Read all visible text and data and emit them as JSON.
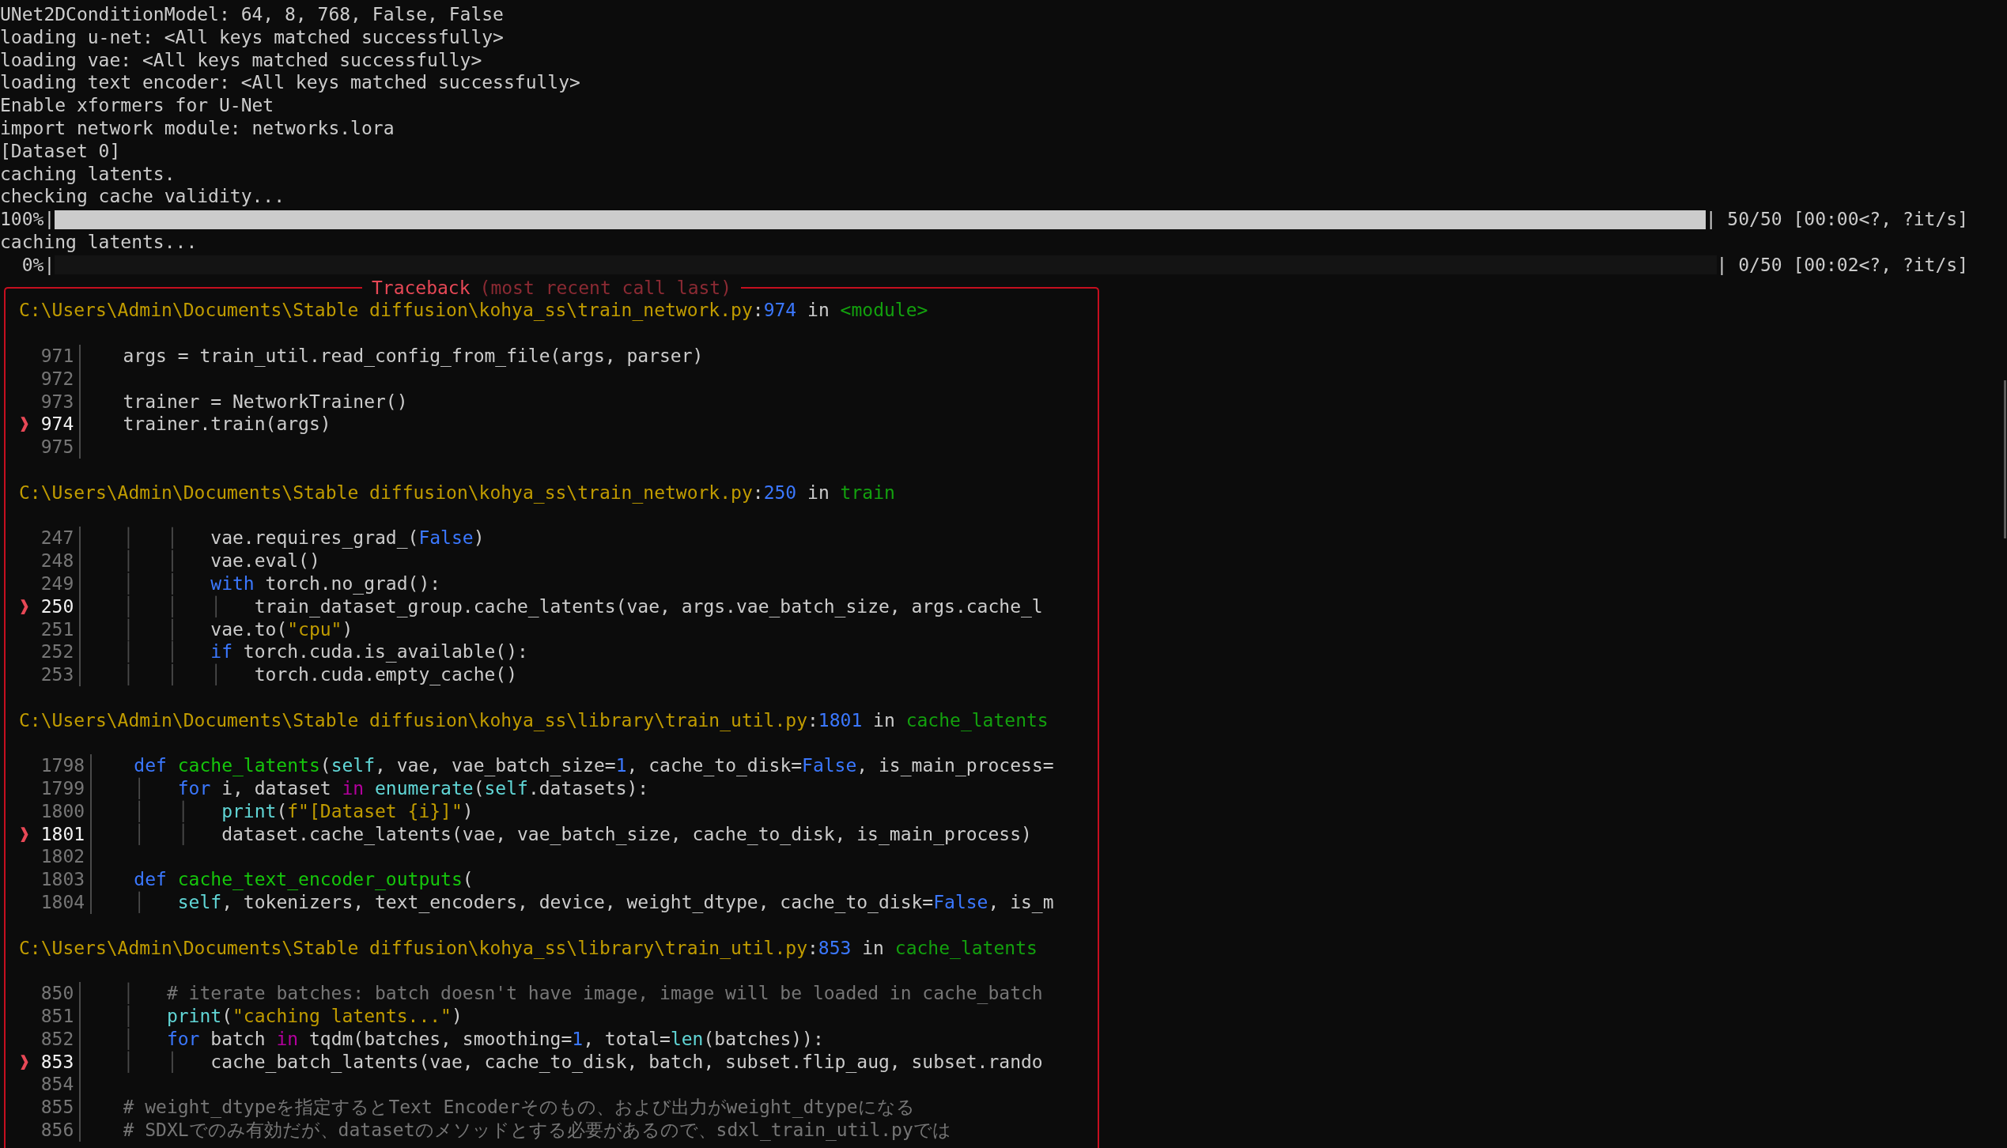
{
  "output": [
    {
      "kind": "text",
      "text": "UNet2DConditionModel: 64, 8, 768, False, False"
    },
    {
      "kind": "text",
      "text": "loading u-net: <All keys matched successfully>"
    },
    {
      "kind": "text",
      "text": "loading vae: <All keys matched successfully>"
    },
    {
      "kind": "text",
      "text": "loading text encoder: <All keys matched successfully>"
    },
    {
      "kind": "text",
      "text": "Enable xformers for U-Net"
    },
    {
      "kind": "text",
      "text": "import network module: networks.lora"
    },
    {
      "kind": "text",
      "text": "[Dataset 0]"
    },
    {
      "kind": "text",
      "text": "caching latents."
    },
    {
      "kind": "text",
      "text": "checking cache validity..."
    },
    {
      "kind": "progress",
      "prefix": "100%|",
      "level": 1,
      "suffix": "| 50/50 [00:00<?, ?it/s]"
    },
    {
      "kind": "text",
      "text": "caching latents..."
    },
    {
      "kind": "progress",
      "prefix": "  0%|",
      "level": 0,
      "suffix": "| 0/50 [00:02<?, ?it/s]"
    }
  ],
  "traceback": {
    "title": "Traceback",
    "subtitle": "(most recent call last)",
    "frames": [
      {
        "location": {
          "path": "C:\\Users\\Admin\\Documents\\Stable diffusion\\kohya_ss\\train_network.py",
          "separator": ":",
          "line": "974",
          "connector": "in",
          "function": "<module>"
        },
        "lines": [
          {
            "number": "971",
            "current": false,
            "code": [
              {
                "kind": "plain",
                "text": "args = train_util.read_config_from_file(args, parser)"
              }
            ]
          },
          {
            "number": "972",
            "current": false
          },
          {
            "number": "973",
            "current": false,
            "code": [
              {
                "kind": "plain",
                "text": "trainer = NetworkTrainer()"
              }
            ]
          },
          {
            "number": "974",
            "current": true,
            "marker": "❱",
            "code": [
              {
                "kind": "plain",
                "text": "trainer.train(args)"
              }
            ]
          },
          {
            "number": "975",
            "current": false
          }
        ]
      },
      {
        "location": {
          "path": "C:\\Users\\Admin\\Documents\\Stable diffusion\\kohya_ss\\train_network.py",
          "separator": ":",
          "line": "250",
          "connector": "in",
          "function": "train"
        },
        "lines": [
          {
            "number": "247",
            "current": false,
            "code": [
              {
                "kind": "guide",
                "text": "│   │   "
              },
              {
                "kind": "plain",
                "text": "vae.requires_grad_("
              },
              {
                "kind": "const",
                "text": "False"
              },
              {
                "kind": "plain",
                "text": ")"
              }
            ]
          },
          {
            "number": "248",
            "current": false,
            "code": [
              {
                "kind": "guide",
                "text": "│   │   "
              },
              {
                "kind": "plain",
                "text": "vae.eval()"
              }
            ]
          },
          {
            "number": "249",
            "current": false,
            "code": [
              {
                "kind": "guide",
                "text": "│   │   "
              },
              {
                "kind": "keyword",
                "text": "with"
              },
              {
                "kind": "plain",
                "text": " torch.no_grad():"
              }
            ]
          },
          {
            "number": "250",
            "current": true,
            "marker": "❱",
            "code": [
              {
                "kind": "guide",
                "text": "│   │   │   "
              },
              {
                "kind": "plain",
                "text": "train_dataset_group.cache_latents(vae, args.vae_batch_size, args.cache_l"
              }
            ]
          },
          {
            "number": "251",
            "current": false,
            "code": [
              {
                "kind": "guide",
                "text": "│   │   "
              },
              {
                "kind": "plain",
                "text": "vae.to("
              },
              {
                "kind": "string",
                "text": "\"cpu\""
              },
              {
                "kind": "plain",
                "text": ")"
              }
            ]
          },
          {
            "number": "252",
            "current": false,
            "code": [
              {
                "kind": "guide",
                "text": "│   │   "
              },
              {
                "kind": "keyword",
                "text": "if"
              },
              {
                "kind": "plain",
                "text": " torch.cuda.is_available():"
              }
            ]
          },
          {
            "number": "253",
            "current": false,
            "code": [
              {
                "kind": "guide",
                "text": "│   │   │   "
              },
              {
                "kind": "plain",
                "text": "torch.cuda.empty_cache()"
              }
            ]
          }
        ]
      },
      {
        "location": {
          "path": "C:\\Users\\Admin\\Documents\\Stable diffusion\\kohya_ss\\library\\train_util.py",
          "separator": ":",
          "line": "1801",
          "connector": "in",
          "function": "cache_latents"
        },
        "lines": [
          {
            "number": "1798",
            "current": false,
            "code": [
              {
                "kind": "keyword",
                "text": "def "
              },
              {
                "kind": "function",
                "text": "cache_latents"
              },
              {
                "kind": "plain",
                "text": "("
              },
              {
                "kind": "builtin",
                "text": "self"
              },
              {
                "kind": "plain",
                "text": ", vae, vae_batch_size="
              },
              {
                "kind": "number",
                "text": "1"
              },
              {
                "kind": "plain",
                "text": ", cache_to_disk="
              },
              {
                "kind": "const",
                "text": "False"
              },
              {
                "kind": "plain",
                "text": ", is_main_process="
              }
            ]
          },
          {
            "number": "1799",
            "current": false,
            "code": [
              {
                "kind": "guide",
                "text": "│   "
              },
              {
                "kind": "keyword",
                "text": "for"
              },
              {
                "kind": "plain",
                "text": " i, dataset "
              },
              {
                "kind": "operator",
                "text": "in "
              },
              {
                "kind": "builtin",
                "text": "enumerate"
              },
              {
                "kind": "plain",
                "text": "("
              },
              {
                "kind": "builtin",
                "text": "self"
              },
              {
                "kind": "plain",
                "text": ".datasets):"
              }
            ]
          },
          {
            "number": "1800",
            "current": false,
            "code": [
              {
                "kind": "guide",
                "text": "│   │   "
              },
              {
                "kind": "builtin",
                "text": "print"
              },
              {
                "kind": "plain",
                "text": "("
              },
              {
                "kind": "string",
                "text": "f\"[Dataset {i}]\""
              },
              {
                "kind": "plain",
                "text": ")"
              }
            ]
          },
          {
            "number": "1801",
            "current": true,
            "marker": "❱",
            "code": [
              {
                "kind": "guide",
                "text": "│   │   "
              },
              {
                "kind": "plain",
                "text": "dataset.cache_latents(vae, vae_batch_size, cache_to_disk, is_main_process)"
              }
            ]
          },
          {
            "number": "1802",
            "current": false
          },
          {
            "number": "1803",
            "current": false,
            "code": [
              {
                "kind": "keyword",
                "text": "def "
              },
              {
                "kind": "function",
                "text": "cache_text_encoder_outputs"
              },
              {
                "kind": "plain",
                "text": "("
              }
            ]
          },
          {
            "number": "1804",
            "current": false,
            "code": [
              {
                "kind": "guide",
                "text": "│   "
              },
              {
                "kind": "builtin",
                "text": "self"
              },
              {
                "kind": "plain",
                "text": ", tokenizers, text_encoders, device, weight_dtype, cache_to_disk="
              },
              {
                "kind": "const",
                "text": "False"
              },
              {
                "kind": "plain",
                "text": ", is_m"
              }
            ]
          }
        ]
      },
      {
        "location": {
          "path": "C:\\Users\\Admin\\Documents\\Stable diffusion\\kohya_ss\\library\\train_util.py",
          "separator": ":",
          "line": "853",
          "connector": "in",
          "function": "cache_latents"
        },
        "lines": [
          {
            "number": "850",
            "current": false,
            "code": [
              {
                "kind": "guide",
                "text": "│   "
              },
              {
                "kind": "comment",
                "text": "# iterate batches: batch doesn't have image, image will be loaded in cache_batch"
              }
            ]
          },
          {
            "number": "851",
            "current": false,
            "code": [
              {
                "kind": "guide",
                "text": "│   "
              },
              {
                "kind": "builtin",
                "text": "print"
              },
              {
                "kind": "plain",
                "text": "("
              },
              {
                "kind": "string",
                "text": "\"caching latents...\""
              },
              {
                "kind": "plain",
                "text": ")"
              }
            ]
          },
          {
            "number": "852",
            "current": false,
            "code": [
              {
                "kind": "guide",
                "text": "│   "
              },
              {
                "kind": "keyword",
                "text": "for"
              },
              {
                "kind": "plain",
                "text": " batch "
              },
              {
                "kind": "operator",
                "text": "in"
              },
              {
                "kind": "plain",
                "text": " tqdm(batches, smoothing="
              },
              {
                "kind": "number",
                "text": "1"
              },
              {
                "kind": "plain",
                "text": ", total="
              },
              {
                "kind": "builtin",
                "text": "len"
              },
              {
                "kind": "plain",
                "text": "(batches)):"
              }
            ]
          },
          {
            "number": "853",
            "current": true,
            "marker": "❱",
            "code": [
              {
                "kind": "guide",
                "text": "│   │   "
              },
              {
                "kind": "plain",
                "text": "cache_batch_latents(vae, cache_to_disk, batch, subset.flip_aug, subset.rando"
              }
            ]
          },
          {
            "number": "854",
            "current": false
          },
          {
            "number": "855",
            "current": false,
            "code": [
              {
                "kind": "comment",
                "text": "# weight_dtypeを指定するとText Encoderそのもの、および出力がweight_dtypeになる"
              }
            ]
          },
          {
            "number": "856",
            "current": false,
            "code": [
              {
                "kind": "comment",
                "text": "# SDXLでのみ有効だが、datasetのメソッドとする必要があるので、sdxl_train_util.pyでは"
              }
            ]
          }
        ]
      }
    ]
  }
}
